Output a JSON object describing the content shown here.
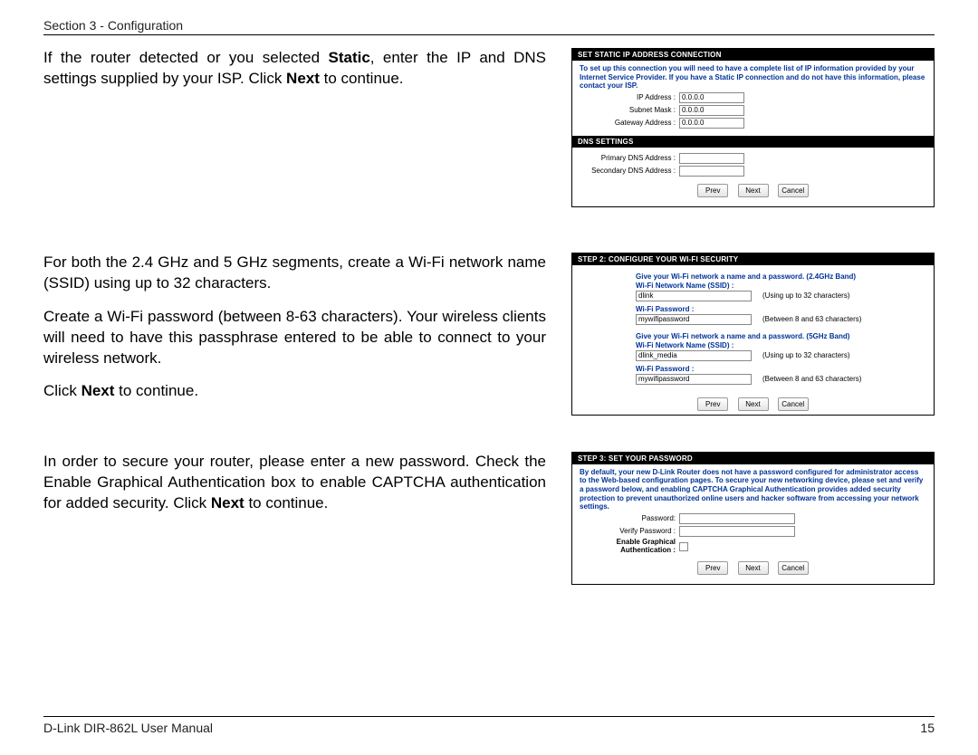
{
  "header": {
    "section_label": "Section 3 - Configuration"
  },
  "text": {
    "static_pre": "If the router detected or you selected ",
    "static_bold": "Static",
    "static_post": ", enter the IP and DNS settings supplied by your ISP. Click ",
    "static_bold2": "Next",
    "static_post2": " to continue.",
    "wifi_para1": "For both the 2.4 GHz and 5 GHz segments, create a Wi-Fi network name (SSID) using up to 32 characters.",
    "wifi_para2": "Create a Wi-Fi password (between 8-63 characters).  Your wireless clients will need to have this passphrase entered to be able to connect to your wireless network.",
    "click_next_pre": "Click ",
    "click_next_bold": "Next",
    "click_next_post": " to continue.",
    "pwd_pre": "In order to secure your router, please enter a new password. Check the Enable Graphical Authentication box to enable CAPTCHA authentication for added security. Click ",
    "pwd_bold": "Next",
    "pwd_post": " to continue."
  },
  "panel1": {
    "bar1": "SET STATIC IP ADDRESS CONNECTION",
    "info": "To set up this connection you will need to have a complete list of IP information provided by your Internet Service Provider. If you have a Static IP connection and do not have this information, please contact your ISP.",
    "ip_label": "IP Address :",
    "ip_value": "0.0.0.0",
    "subnet_label": "Subnet Mask :",
    "subnet_value": "0.0.0.0",
    "gw_label": "Gateway Address :",
    "gw_value": "0.0.0.0",
    "bar2": "DNS SETTINGS",
    "pdns_label": "Primary DNS Address :",
    "sdns_label": "Secondary DNS Address :"
  },
  "panel2": {
    "bar": "STEP 2: CONFIGURE YOUR WI-FI SECURITY",
    "group24": "Give your Wi-Fi network a name and a password.  (2.4GHz Band)",
    "ssid_label": "Wi-Fi Network Name (SSID) :",
    "ssid24_value": "dlink",
    "ssid_hint": "(Using up to 32 characters)",
    "pwd_label": "Wi-Fi Password :",
    "pwd24_value": "mywifipassword",
    "pwd_hint": "(Between 8 and 63 characters)",
    "group5": "Give your Wi-Fi network a name and a password.  (5GHz Band)",
    "ssid5_value": "dlink_media",
    "pwd5_value": "mywifipassword"
  },
  "panel3": {
    "bar": "STEP 3: SET YOUR PASSWORD",
    "info": "By default, your new D-Link Router does not have a password configured for administrator access to the Web-based configuration pages. To secure your new networking device, please set and verify a password below, and enabling CAPTCHA Graphical Authentication provides added security protection to prevent unauthorized online users and hacker software from accessing your network settings.",
    "pwd_label": "Password:",
    "vpwd_label": "Verify Password :",
    "captcha_label1": "Enable Graphical",
    "captcha_label2": "Authentication :"
  },
  "buttons": {
    "prev": "Prev",
    "next": "Next",
    "cancel": "Cancel"
  },
  "footer": {
    "manual": "D-Link DIR-862L User Manual",
    "page": "15"
  }
}
